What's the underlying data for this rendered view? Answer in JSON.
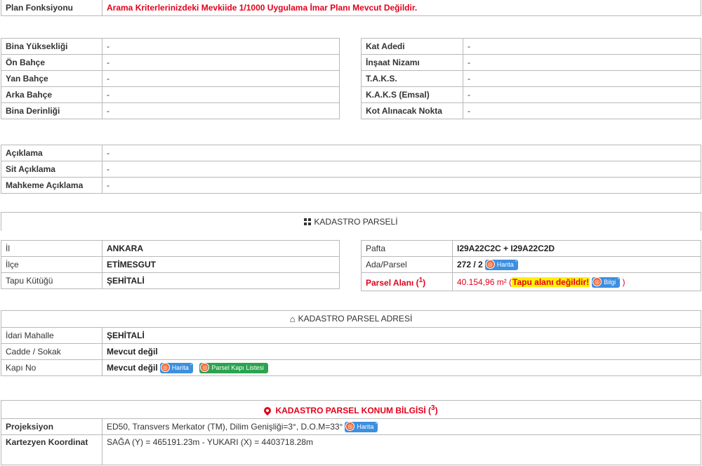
{
  "plan": {
    "label": "Plan Fonksiyonu",
    "value": "Arama Kriterlerinizdeki Mevkiide 1/1000 Uygulama İmar Planı Mevcut Değildir."
  },
  "bina_left": [
    {
      "label": "Bina Yüksekliği",
      "value": "-"
    },
    {
      "label": "Ön Bahçe",
      "value": "-"
    },
    {
      "label": "Yan Bahçe",
      "value": "-"
    },
    {
      "label": "Arka Bahçe",
      "value": "-"
    },
    {
      "label": "Bina Derinliği",
      "value": "-"
    }
  ],
  "bina_right": [
    {
      "label": "Kat Adedi",
      "value": "-"
    },
    {
      "label": "İnşaat Nizamı",
      "value": "-"
    },
    {
      "label": "T.A.K.S.",
      "value": "-"
    },
    {
      "label": "K.A.K.S (Emsal)",
      "value": "-"
    },
    {
      "label": "Kot Alınacak Nokta",
      "value": "-"
    }
  ],
  "aciklama": [
    {
      "label": "Açıklama",
      "value": "-"
    },
    {
      "label": "Sit Açıklama",
      "value": "-"
    },
    {
      "label": "Mahkeme Açıklama",
      "value": "-"
    }
  ],
  "kadastro": {
    "title": "KADASTRO PARSELİ",
    "left": [
      {
        "label": "İl",
        "value": "ANKARA"
      },
      {
        "label": "İlçe",
        "value": "ETİMESGUT"
      },
      {
        "label": "Tapu Kütüğü",
        "value": "ŞEHİTALİ"
      }
    ],
    "pafta_label": "Pafta",
    "pafta_value": "I29A22C2C + I29A22C2D",
    "ada_label": "Ada/Parsel",
    "ada_value": "272 / 2",
    "alan_label": "Parsel Alanı (",
    "alan_sup": "1",
    "alan_close": ")",
    "alan_value": "40.154,96 m² (",
    "alan_warning": "Tapu alanı değildir!",
    "alan_end": ")",
    "harita_label": "Harita",
    "bilgi_label": "Bilgi"
  },
  "adres": {
    "title": "KADASTRO PARSEL ADRESİ",
    "rows": [
      {
        "label": "İdari Mahalle",
        "value": "ŞEHİTALİ"
      },
      {
        "label": "Cadde / Sokak",
        "value": "Mevcut değil"
      },
      {
        "label": "Kapı No",
        "value": "Mevcut değil"
      }
    ],
    "harita_label": "Harita",
    "kapi_listesi_label": "Parsel Kapı Listesi"
  },
  "konum": {
    "title": "KADASTRO PARSEL KONUM BİLGİSİ (",
    "title_sup": "3",
    "title_close": ")",
    "projeksiyon_label": "Projeksiyon",
    "projeksiyon_value": "ED50, Transvers Merkator (TM), Dilim Genişliği=3°, D.O.M=33°",
    "kartezyen_label": "Kartezyen Koordinat",
    "kartezyen_value": "SAĞA (Y) = 465191.23m - YUKARI (X) = 4403718.28m",
    "harita_label": "Harita"
  },
  "colors": {
    "accent_red": "#e3001b",
    "button_blue": "#3d8fe0",
    "button_green": "#2ba34f",
    "warning_yellow": "#fff200"
  }
}
